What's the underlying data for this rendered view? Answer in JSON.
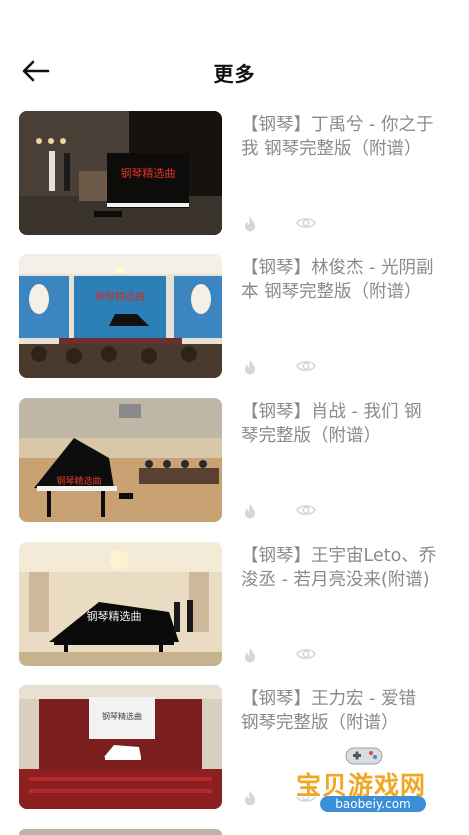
{
  "header": {
    "title": "更多"
  },
  "items": [
    {
      "title": "【钢琴】丁禹兮 - 你之于我 钢琴完整版（附谱）",
      "thumb_text": "钢琴精选曲"
    },
    {
      "title": "【钢琴】林俊杰 - 光阴副本 钢琴完整版（附谱）",
      "thumb_text": "钢琴精选曲"
    },
    {
      "title": "【钢琴】肖战 - 我们 钢琴完整版（附谱）",
      "thumb_text": "钢琴精选曲"
    },
    {
      "title": "【钢琴】王宇宙Leto、乔浚丞 - 若月亮没来(附谱)",
      "thumb_text": "钢琴精选曲"
    },
    {
      "title": "【钢琴】王力宏 - 爱错 钢琴完整版（附谱）",
      "thumb_text": "钢琴精选曲"
    }
  ],
  "watermark": {
    "main": "宝贝游戏网",
    "sub": "baobeiy.com"
  },
  "colors": {
    "title_text": "#8a8a8a",
    "icon": "#d6d6d6",
    "watermark": "#f2a623"
  }
}
